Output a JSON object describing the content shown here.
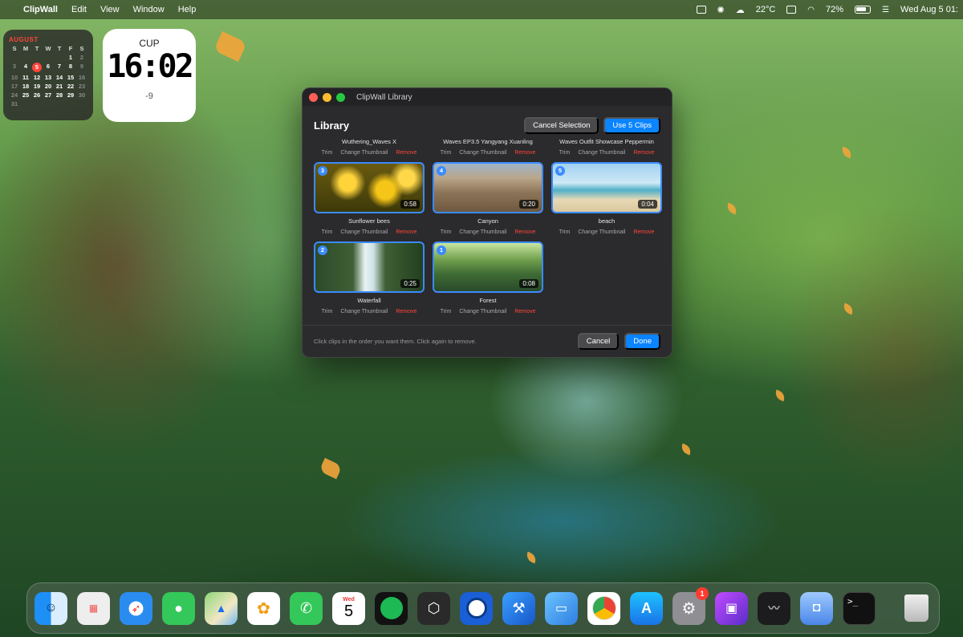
{
  "menubar": {
    "app_name": "ClipWall",
    "menus": [
      "Edit",
      "View",
      "Window",
      "Help"
    ],
    "temperature": "22°C",
    "battery": "72%",
    "datetime": "Wed Aug 5 01:"
  },
  "calendar_widget": {
    "month": "AUGUST",
    "dow": [
      "S",
      "M",
      "T",
      "W",
      "T",
      "F",
      "S"
    ],
    "days": [
      [
        "",
        "",
        "",
        "",
        "",
        "1",
        "2"
      ],
      [
        "3",
        "4",
        "5",
        "6",
        "7",
        "8",
        "9"
      ],
      [
        "10",
        "11",
        "12",
        "13",
        "14",
        "15",
        "16"
      ],
      [
        "17",
        "18",
        "19",
        "20",
        "21",
        "22",
        "23"
      ],
      [
        "24",
        "25",
        "26",
        "27",
        "28",
        "29",
        "30"
      ],
      [
        "31",
        "",
        "",
        "",
        "",
        "",
        ""
      ]
    ],
    "today": "5"
  },
  "clock_widget": {
    "city": "CUP",
    "time": "16:02",
    "offset": "-9"
  },
  "window": {
    "title": "ClipWall Library",
    "library_label": "Library",
    "cancel_selection": "Cancel Selection",
    "use_clips": "Use 5 Clips",
    "action_trim": "Trim",
    "action_change_thumbnail": "Change Thumbnail",
    "action_remove": "Remove",
    "top_clips": [
      {
        "name": "Wuthering_Waves X"
      },
      {
        "name": "Waves EP3.5 Yangyang Xuanling"
      },
      {
        "name": "Waves Outfit Showcase Peppermin"
      }
    ],
    "clips": [
      {
        "name": "Sunflower bees",
        "order": "3",
        "duration": "0:58",
        "theme": "sunflower"
      },
      {
        "name": "Canyon",
        "order": "4",
        "duration": "0:20",
        "theme": "canyon"
      },
      {
        "name": "beach",
        "order": "5",
        "duration": "0:04",
        "theme": "beach"
      },
      {
        "name": "Waterfall",
        "order": "2",
        "duration": "0:25",
        "theme": "waterfall"
      },
      {
        "name": "Forest",
        "order": "1",
        "duration": "0:08",
        "theme": "forest"
      }
    ],
    "hint": "Click clips in the order you want them. Click again to remove.",
    "cancel": "Cancel",
    "done": "Done"
  },
  "dock": {
    "calendar_day": "Wed",
    "calendar_date": "5",
    "settings_badge": "1",
    "terminal_glyph": ">_"
  },
  "colors": {
    "accent": "#0a84ff",
    "remove": "#ff453a",
    "selection_border": "#3b8bff"
  }
}
